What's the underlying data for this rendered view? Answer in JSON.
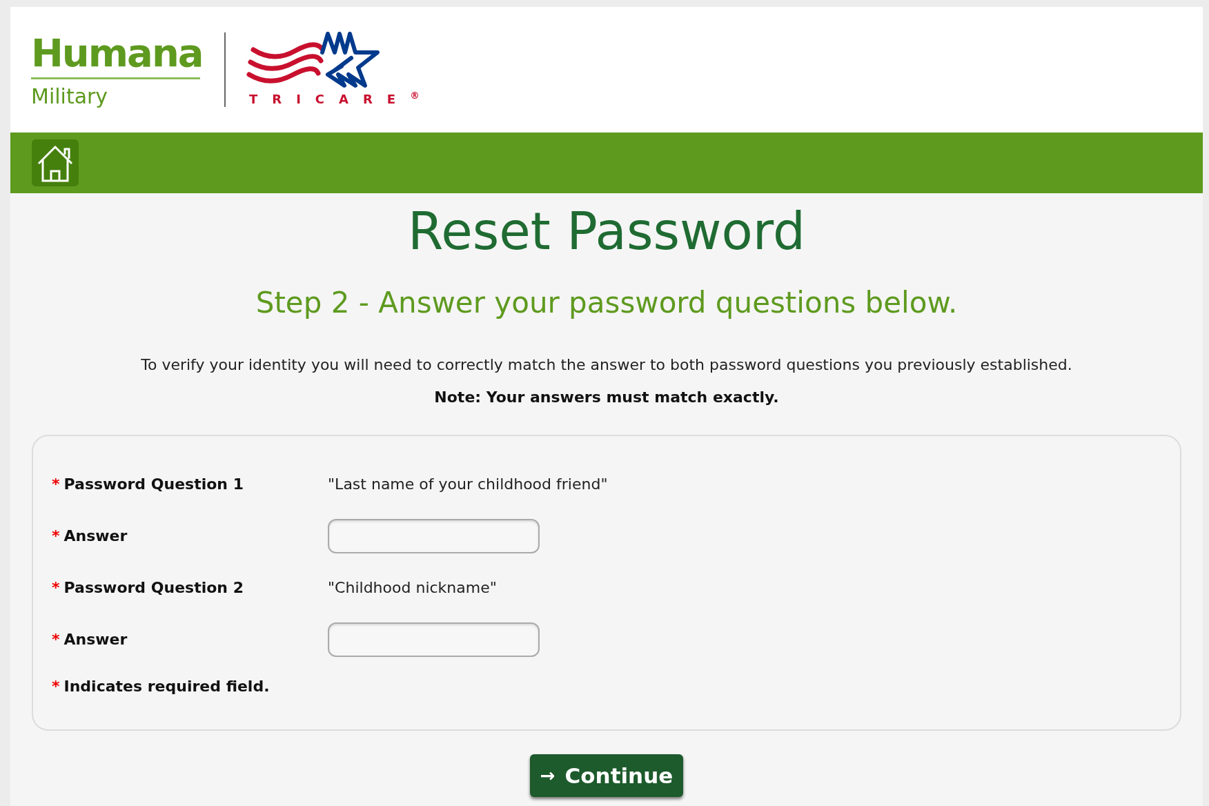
{
  "header": {
    "brand": "Humana",
    "brand_sub": "Military",
    "partner": "TRICARE$^{®}$"
  },
  "title": "Reset Password",
  "step": "Step 2 - Answer your password questions below.",
  "intro": "To verify your identity you will need to correctly match the answer to both password questions you previously established.",
  "note": "Note: Your answers must match exactly.",
  "form": {
    "rows": [
      {
        "kind": "question",
        "required_mark": "*",
        "label": "Password Question 1",
        "value": "\"Last name of your childhood friend\""
      },
      {
        "kind": "answer",
        "required_mark": "*",
        "label": "Answer"
      },
      {
        "kind": "question",
        "required_mark": "*",
        "label": "Password Question 2",
        "value": "\"Childhood nickname\""
      },
      {
        "kind": "answer",
        "required_mark": "*",
        "label": "Answer"
      }
    ],
    "footnote": {
      "required_mark": "*",
      "text": "Indicates required field."
    }
  },
  "button": {
    "icon": "→",
    "label": "Continue"
  }
}
